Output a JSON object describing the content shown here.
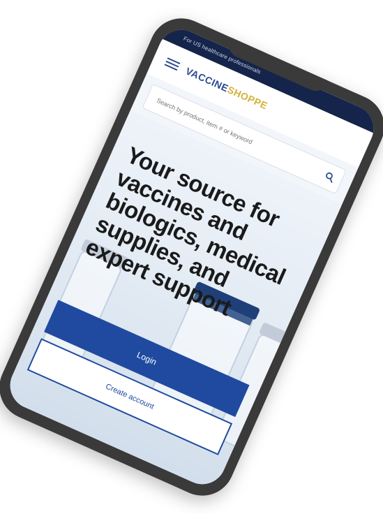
{
  "topbar": {
    "notice": "For US healthcare professionals"
  },
  "header": {
    "logo_main": "VACCINE",
    "logo_accent": "SHOPPE"
  },
  "search": {
    "placeholder": "Search by product, item # or keyword"
  },
  "hero": {
    "title": "Your source for vaccines and biologics, medical supplies, and expert support"
  },
  "actions": {
    "login_label": "Login",
    "create_account_label": "Create account"
  },
  "colors": {
    "brand_blue": "#1f4aa0",
    "topbar_navy": "#15244a",
    "logo_gold": "#d4b13a",
    "phone_frame": "#3a3a3a"
  }
}
